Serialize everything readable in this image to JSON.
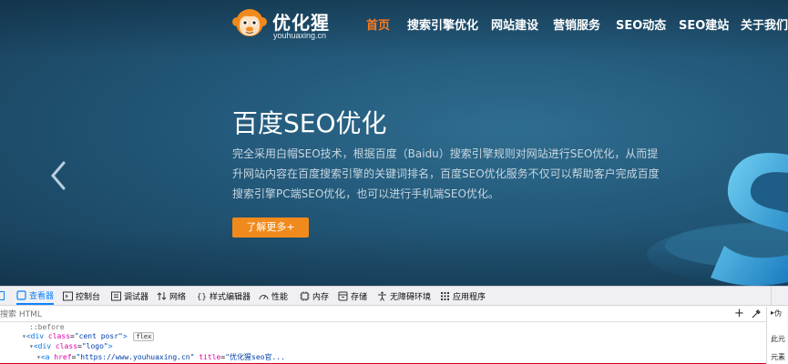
{
  "site": {
    "logo": {
      "title": "优化猩",
      "subtitle": "youhuaxing.cn",
      "icon": "monkey-mascot-icon"
    },
    "nav": [
      {
        "label": "首页",
        "active": true
      },
      {
        "label": "搜索引擎优化",
        "active": false
      },
      {
        "label": "网站建设",
        "active": false
      },
      {
        "label": "营销服务",
        "active": false
      },
      {
        "label": "SEO动态",
        "active": false
      },
      {
        "label": "SEO建站",
        "active": false
      },
      {
        "label": "关于我们",
        "active": false
      }
    ],
    "hero": {
      "title": "百度SEO优化",
      "description": "完全采用白帽SEO技术，根据百度（Baidu）搜索引擎规则对网站进行SEO优化，从而提升网站内容在百度搜索引擎的关键词排名，百度SEO优化服务不仅可以帮助客户完成百度搜索引擎PC端SEO优化，也可以进行手机端SEO优化。",
      "button": "了解更多+"
    },
    "colors": {
      "accent": "#f08a1c",
      "active_nav": "#ff7a1a",
      "hero_bg": "#225778"
    }
  },
  "devtools": {
    "tabs": [
      {
        "label": "查看器",
        "icon": "inspector-icon",
        "active": true
      },
      {
        "label": "控制台",
        "icon": "console-icon",
        "active": false
      },
      {
        "label": "调试器",
        "icon": "debugger-icon",
        "active": false
      },
      {
        "label": "网络",
        "icon": "network-icon",
        "active": false
      },
      {
        "label": "样式编辑器",
        "icon": "style-editor-icon",
        "active": false
      },
      {
        "label": "性能",
        "icon": "performance-icon",
        "active": false
      },
      {
        "label": "内存",
        "icon": "memory-icon",
        "active": false
      },
      {
        "label": "存储",
        "icon": "storage-icon",
        "active": false
      },
      {
        "label": "无障碍环境",
        "icon": "accessibility-icon",
        "active": false
      },
      {
        "label": "应用程序",
        "icon": "application-icon",
        "active": false
      }
    ],
    "search_placeholder": "搜索 HTML",
    "plus": "+",
    "tree": {
      "pseudo": "::before",
      "line1_tag_open": "<div",
      "line1_attr": "class",
      "line1_val": "\"cent posr\"",
      "line1_close": ">",
      "line1_badge": "flex",
      "line2_tag_open": "<div",
      "line2_attr": "class",
      "line2_val": "\"logo\"",
      "line2_close": ">",
      "line3_tag_open": "<a",
      "line3_attr1": "href",
      "line3_val1": "\"https://www.youhuaxing.cn\"",
      "line3_attr2": "title",
      "line3_val2": "\"优化猩seo官..."
    },
    "side": {
      "line1": "伪",
      "line2": "此元",
      "line3": "元素"
    }
  }
}
